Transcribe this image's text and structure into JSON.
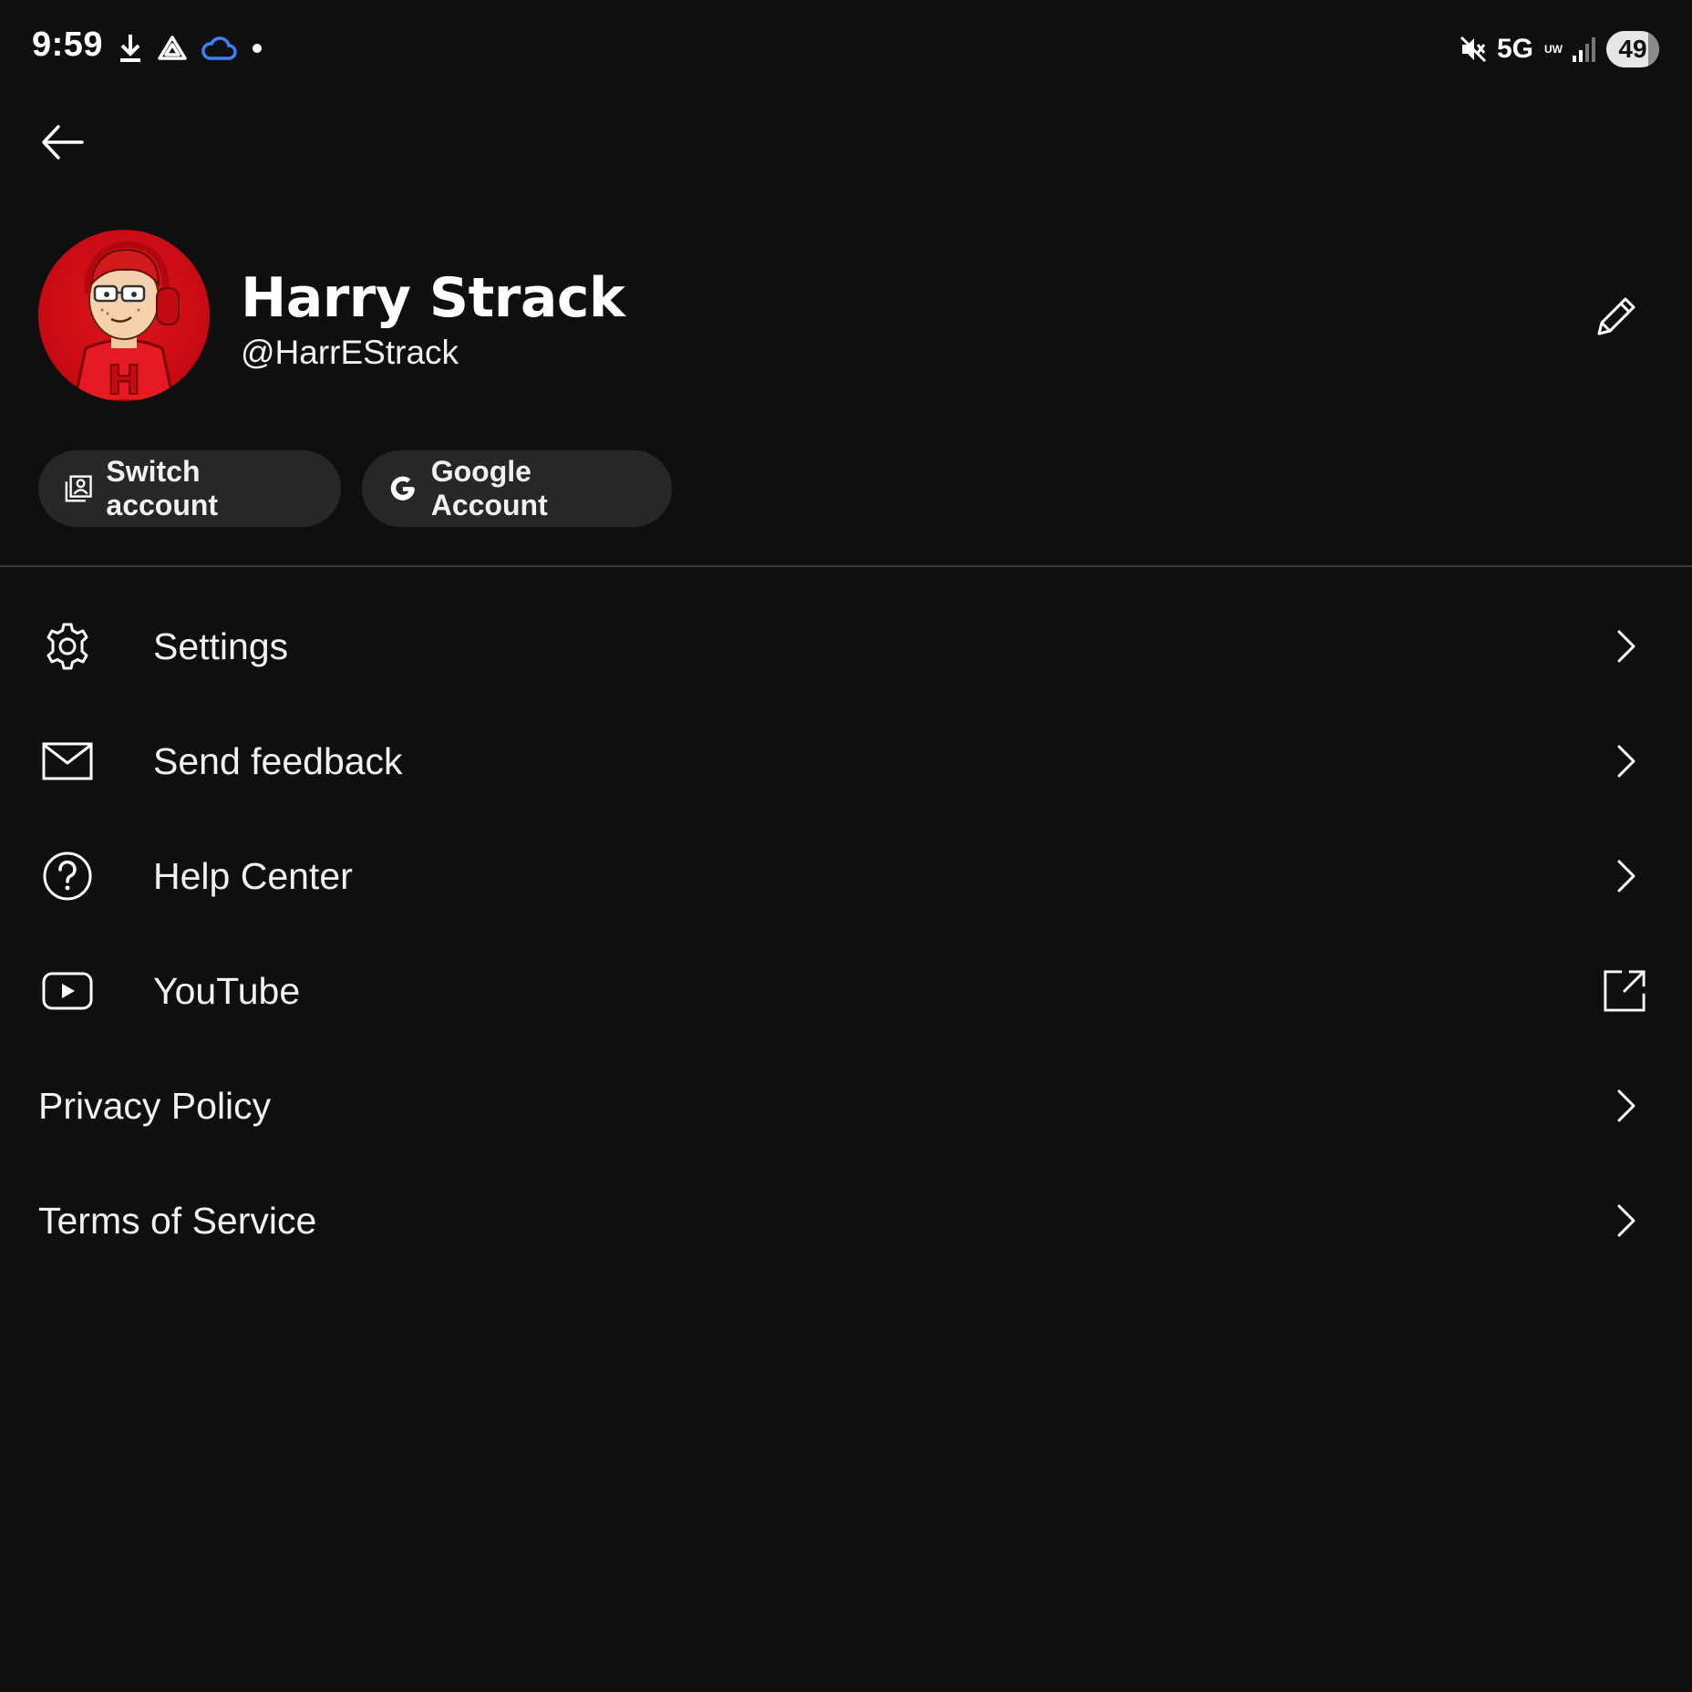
{
  "status_bar": {
    "time": "9:59",
    "network": "5G",
    "network_sub": "UW",
    "battery": "49"
  },
  "profile": {
    "name": "Harry Strack",
    "handle": "@HarrEStrack"
  },
  "chips": {
    "switch_account": "Switch account",
    "google_account": "Google Account"
  },
  "menu": [
    {
      "label": "Settings",
      "icon": "gear-icon"
    },
    {
      "label": "Send feedback",
      "icon": "mail-icon"
    },
    {
      "label": "Help Center",
      "icon": "help-icon"
    },
    {
      "label": "YouTube",
      "icon": "youtube-icon"
    },
    {
      "label": "Privacy Policy"
    },
    {
      "label": "Terms of Service"
    }
  ],
  "colors": {
    "background": "#0f0f10",
    "chip_bg": "#272727",
    "divider": "#3a3a3a",
    "text": "#f1f1f1",
    "cloud_icon": "#3b82f6",
    "avatar_red": "#d10f17"
  }
}
